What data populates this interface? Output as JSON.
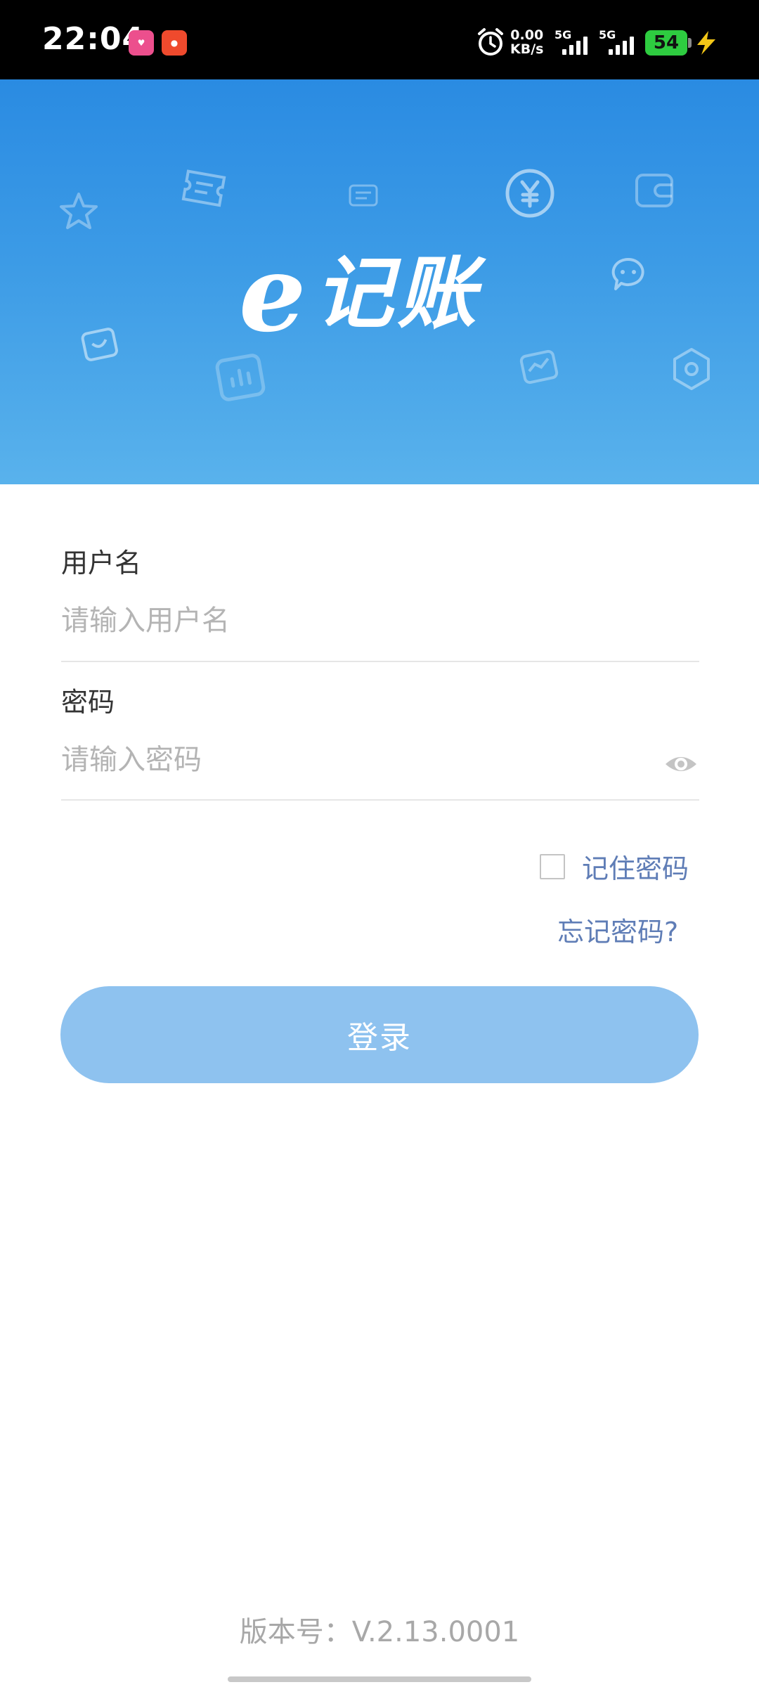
{
  "status_bar": {
    "time": "22:04",
    "net_speed_value": "0.00",
    "net_speed_unit": "KB/s",
    "sim1": "5G",
    "sim2": "5G",
    "battery": "54",
    "icons": [
      "app-icon-1",
      "app-icon-2",
      "alarm-icon",
      "signal-icon",
      "battery-icon",
      "charging-icon"
    ]
  },
  "banner": {
    "logo_e": "e",
    "logo_text": "记账",
    "colors": {
      "top": "#2a8be2",
      "bottom": "#59b2ec"
    }
  },
  "form": {
    "username_label": "用户名",
    "username_placeholder": "请输入用户名",
    "password_label": "密码",
    "password_placeholder": "请输入密码",
    "remember_label": "记住密码",
    "remember_checked": false,
    "forgot_label": "忘记密码?",
    "login_label": "登录"
  },
  "footer": {
    "version": "版本号：V.2.13.0001"
  },
  "colors": {
    "accent_link": "#5f7db6",
    "button_bg": "#8ec2ef"
  }
}
